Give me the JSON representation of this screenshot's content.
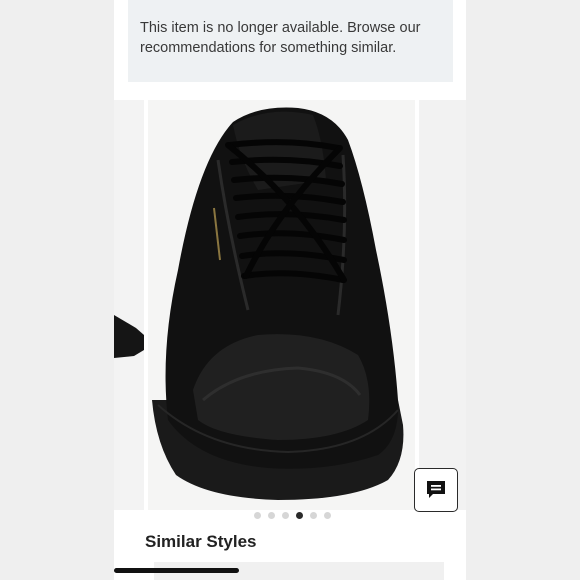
{
  "notice": {
    "line1": "This item is no longer available. Browse our",
    "line2": "recommendations for something similar."
  },
  "carousel": {
    "slide_count": 6,
    "active_index": 3,
    "product_image": "black-leather-low-top-sneaker"
  },
  "chat": {
    "icon": "chat-icon"
  },
  "similar": {
    "title": "Similar Styles"
  },
  "colors": {
    "notice_bg": "#eef1f3",
    "text": "#393939",
    "dot_active": "#2b2b2b",
    "dot_inactive": "#d6d6d6"
  }
}
